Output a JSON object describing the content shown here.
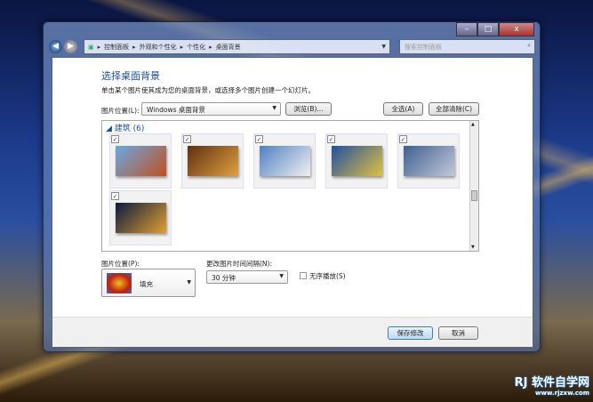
{
  "window": {
    "controls": {
      "minimize": "–",
      "maximize": "□",
      "close": "x"
    }
  },
  "address": {
    "crumbs": [
      "控制面板",
      "外观和个性化",
      "个性化",
      "桌面背景"
    ],
    "search_placeholder": "搜索控制面板"
  },
  "main": {
    "title": "选择桌面背景",
    "description": "单击某个图片使其成为您的桌面背景，或选择多个图片创建一个幻灯片。",
    "location_label": "图片位置(L):",
    "location_value": "Windows 桌面背景",
    "browse": "浏览(B)...",
    "select_all": "全选(A)",
    "clear_all": "全部清除(C)",
    "group": "建筑 (6)",
    "thumbnails": [
      {
        "checked": true,
        "colors": [
          "#6aa8e0",
          "#c05020"
        ]
      },
      {
        "checked": true,
        "colors": [
          "#603010",
          "#e0a040"
        ]
      },
      {
        "checked": true,
        "colors": [
          "#5080c0",
          "#f0f0f0"
        ]
      },
      {
        "checked": true,
        "colors": [
          "#2050a0",
          "#e0c040"
        ]
      },
      {
        "checked": true,
        "colors": [
          "#406090",
          "#c0c8d8"
        ]
      },
      {
        "checked": true,
        "colors": [
          "#0a1a40",
          "#e0a030"
        ]
      }
    ],
    "position_label": "图片位置(P):",
    "position_value": "填充",
    "interval_label": "更改图片时间间隔(N):",
    "interval_value": "30 分钟",
    "shuffle_label": "无序播放(S)",
    "shuffle_checked": false
  },
  "footer": {
    "save": "保存修改",
    "cancel": "取消"
  },
  "watermark": {
    "text": "软件自学网",
    "url": "www.rjzxw.com"
  }
}
